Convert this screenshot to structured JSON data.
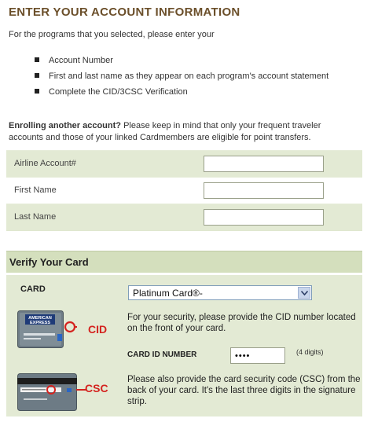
{
  "header": {
    "title": "ENTER YOUR ACCOUNT INFORMATION"
  },
  "intro": {
    "text": "For the programs that you selected, please enter your"
  },
  "requirements": [
    "Account Number",
    "First and last name as they appear on each program's account statement",
    "Complete the CID/3CSC Verification"
  ],
  "enroll": {
    "bold": "Enrolling another account?",
    "text": " Please keep in mind that only your frequent traveler accounts and those of your linked Cardmembers are eligible for point transfers."
  },
  "form": {
    "airline_label": "Airline Account#",
    "first_name_label": "First Name",
    "last_name_label": "Last Name",
    "airline_value": "",
    "first_name_value": "",
    "last_name_value": ""
  },
  "verify": {
    "title": "Verify Your Card",
    "card_label": "CARD",
    "card_selected": "Platinum Card®-",
    "card_image_brand_line1": "AMERICAN",
    "card_image_brand_line2": "EXPRESS",
    "cid_callout": "CID",
    "csc_callout": "CSC",
    "cid_instructions": "For your security, please provide the CID number located on the front of your card.",
    "card_id_label": "CARD ID NUMBER",
    "card_id_value": "••••",
    "digits_hint": "(4 digits)",
    "csc_instructions": "Please also provide the card security code (CSC) from the back of your card. It's the last three digits in the signature strip."
  },
  "colors": {
    "title": "#6b4f2a",
    "shaded_row": "#e3ead4",
    "section_header": "#d4dfbd",
    "callout_red": "#d4231f"
  }
}
